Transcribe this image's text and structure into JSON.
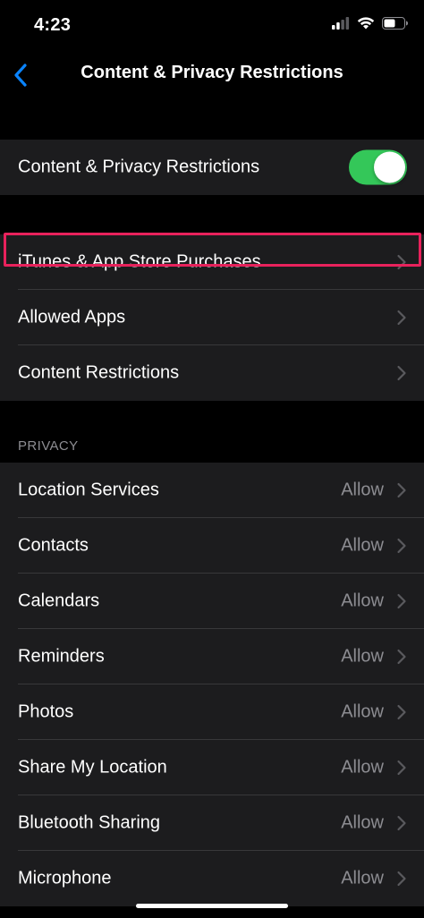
{
  "status_bar": {
    "time": "4:23"
  },
  "nav": {
    "title": "Content & Privacy Restrictions"
  },
  "master_toggle": {
    "label": "Content & Privacy Restrictions",
    "on": true,
    "on_color": "#34c759"
  },
  "store_group": [
    {
      "label": "iTunes & App Store Purchases",
      "highlighted": true
    },
    {
      "label": "Allowed Apps"
    },
    {
      "label": "Content Restrictions"
    }
  ],
  "privacy": {
    "header": "PRIVACY",
    "rows": [
      {
        "label": "Location Services",
        "value": "Allow"
      },
      {
        "label": "Contacts",
        "value": "Allow"
      },
      {
        "label": "Calendars",
        "value": "Allow"
      },
      {
        "label": "Reminders",
        "value": "Allow"
      },
      {
        "label": "Photos",
        "value": "Allow"
      },
      {
        "label": "Share My Location",
        "value": "Allow"
      },
      {
        "label": "Bluetooth Sharing",
        "value": "Allow"
      },
      {
        "label": "Microphone",
        "value": "Allow"
      }
    ]
  },
  "colors": {
    "accent": "#0a84ff",
    "highlight_border": "#e8225c",
    "background": "#000000",
    "cell_background": "#1c1c1e"
  },
  "icons": [
    "back-chevron-icon",
    "cellular-signal-icon",
    "wifi-icon",
    "battery-icon",
    "chevron-right-icon"
  ]
}
